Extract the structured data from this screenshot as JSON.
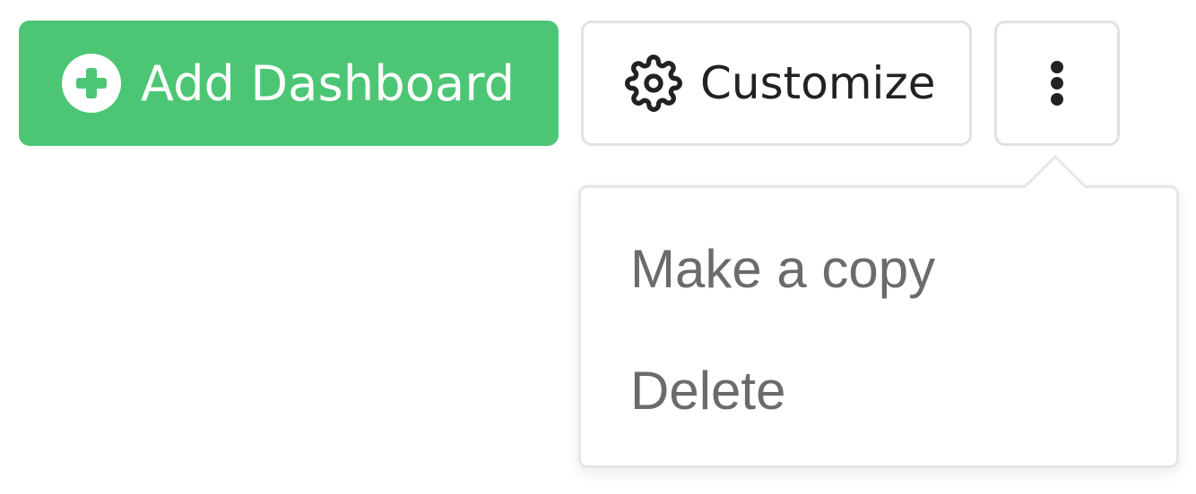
{
  "toolbar": {
    "add_dashboard": {
      "label": "Add Dashboard",
      "icon": "plus-circle-icon",
      "color": "#4cc675"
    },
    "customize": {
      "label": "Customize",
      "icon": "gear-icon"
    },
    "more": {
      "icon": "more-vertical-icon"
    }
  },
  "dropdown": {
    "items": [
      {
        "label": "Make a copy"
      },
      {
        "label": "Delete"
      }
    ]
  }
}
